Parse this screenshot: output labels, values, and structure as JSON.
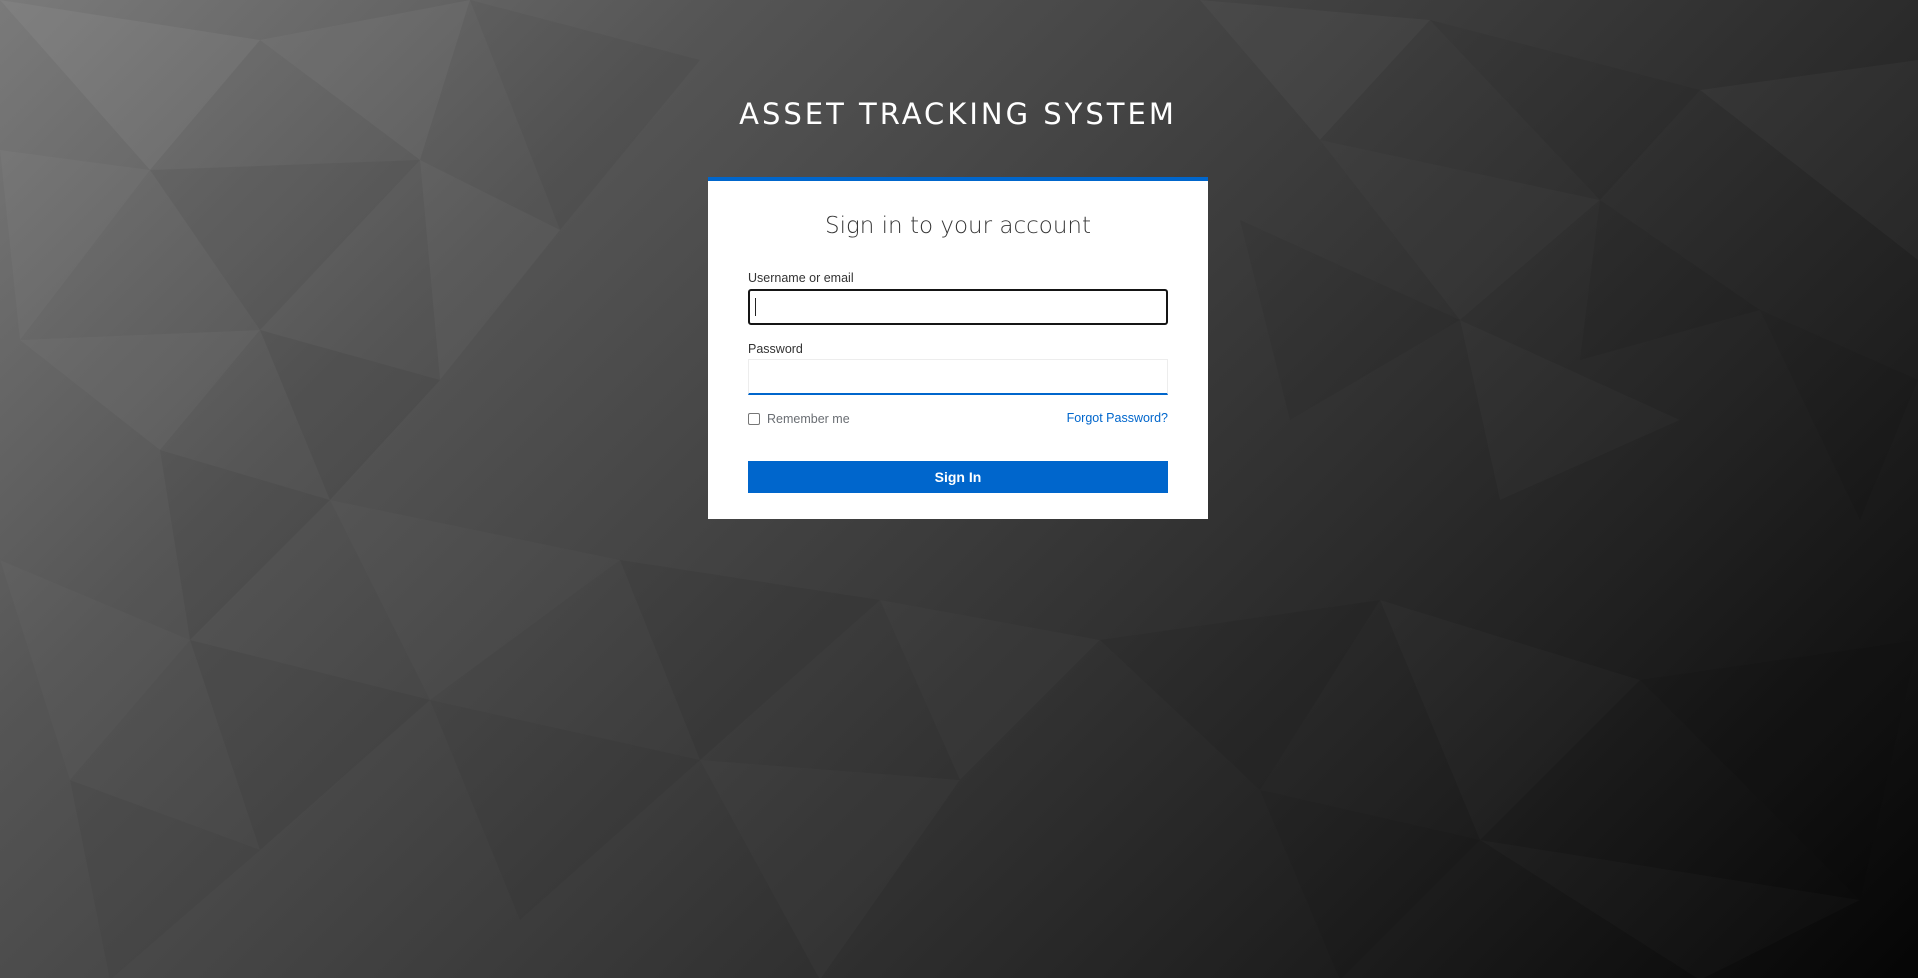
{
  "app": {
    "title": "ASSET TRACKING SYSTEM"
  },
  "login": {
    "heading": "Sign in to your account",
    "username_label": "Username or email",
    "username_value": "",
    "password_label": "Password",
    "password_value": "",
    "remember_label": "Remember me",
    "remember_checked": false,
    "forgot_label": "Forgot Password?",
    "submit_label": "Sign In"
  },
  "colors": {
    "accent": "#0066cc",
    "card_background": "#ffffff",
    "background_light": "#7a7a7a",
    "background_dark": "#050505"
  },
  "icons": {
    "background": "low-poly-triangle-pattern"
  }
}
